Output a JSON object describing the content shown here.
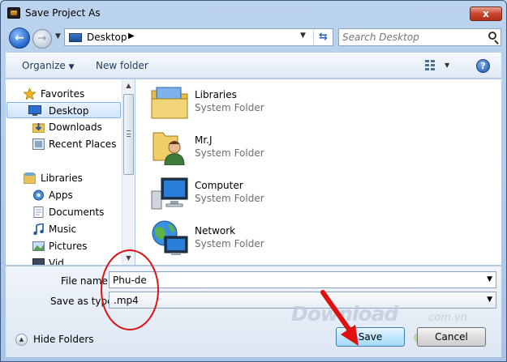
{
  "window": {
    "title": "Save Project As",
    "close_label": "x"
  },
  "navigation": {
    "address": {
      "location": "Desktop"
    },
    "search": {
      "placeholder": "Search Desktop"
    }
  },
  "toolbar": {
    "organize_label": "Organize",
    "new_folder_label": "New folder",
    "help_label": "?"
  },
  "sidebar": {
    "items": [
      {
        "label": "Favorites",
        "icon": "star-icon",
        "section": true
      },
      {
        "label": "Desktop",
        "icon": "desktop-icon",
        "selected": true
      },
      {
        "label": "Downloads",
        "icon": "downloads-icon"
      },
      {
        "label": "Recent Places",
        "icon": "recent-places-icon"
      },
      {
        "label": "Libraries",
        "icon": "libraries-icon",
        "section": true
      },
      {
        "label": "Apps",
        "icon": "apps-icon"
      },
      {
        "label": "Documents",
        "icon": "documents-icon"
      },
      {
        "label": "Music",
        "icon": "music-icon"
      },
      {
        "label": "Pictures",
        "icon": "pictures-icon"
      },
      {
        "label": "Vid",
        "icon": "videos-icon"
      }
    ]
  },
  "files": [
    {
      "name": "Libraries",
      "type": "System Folder",
      "icon": "libraries-folder-icon"
    },
    {
      "name": "Mr.J",
      "type": "System Folder",
      "icon": "user-folder-icon"
    },
    {
      "name": "Computer",
      "type": "System Folder",
      "icon": "computer-icon"
    },
    {
      "name": "Network",
      "type": "System Folder",
      "icon": "network-icon"
    }
  ],
  "form": {
    "file_name_label": "File name:",
    "file_name_value": "Phu-de",
    "save_as_type_label": "Save as type:",
    "save_as_type_value": ".mp4"
  },
  "footer": {
    "hide_folders_label": "Hide Folders",
    "save_label": "Save",
    "cancel_label": "Cancel",
    "watermark": "Download",
    "watermark_suffix": ".com.vn"
  },
  "colors": {
    "accent": "#1f63c8",
    "annotation_red": "#e01010"
  }
}
